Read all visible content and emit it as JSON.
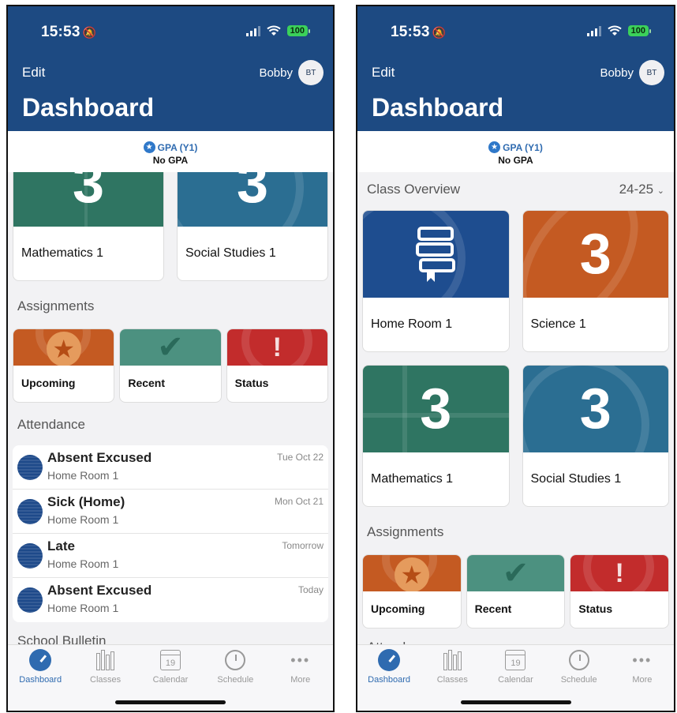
{
  "status": {
    "time": "15:53",
    "battery": "100"
  },
  "header": {
    "edit_label": "Edit",
    "user_name": "Bobby",
    "avatar_initials": "BT",
    "title": "Dashboard"
  },
  "gpa": {
    "label": "GPA (Y1)",
    "value": "No GPA"
  },
  "class_overview": {
    "title": "Class Overview",
    "year": "24-25"
  },
  "classes": [
    {
      "name": "Home Room 1",
      "color": "#1e4d8f"
    },
    {
      "name": "Science 1",
      "badge": "3",
      "color": "#c45a22"
    },
    {
      "name": "Mathematics 1",
      "badge": "3",
      "color": "#2f7562"
    },
    {
      "name": "Social Studies 1",
      "badge": "3",
      "color": "#2b6e92"
    }
  ],
  "assignments": {
    "title": "Assignments",
    "items": [
      {
        "label": "Upcoming",
        "color": "#c45a22"
      },
      {
        "label": "Recent",
        "color": "#2f7562"
      },
      {
        "label": "Status",
        "color": "#c22c2c"
      }
    ]
  },
  "attendance": {
    "title": "Attendance",
    "items": [
      {
        "status": "Absent Excused",
        "class": "Home Room 1",
        "date": "Tue Oct 22"
      },
      {
        "status": "Sick (Home)",
        "class": "Home Room 1",
        "date": "Mon Oct 21"
      },
      {
        "status": "Late",
        "class": "Home Room 1",
        "date": "Tomorrow"
      },
      {
        "status": "Absent Excused",
        "class": "Home Room 1",
        "date": "Today"
      }
    ]
  },
  "bulletin": {
    "title": "School Bulletin"
  },
  "tabbar": {
    "tabs": [
      {
        "label": "Dashboard",
        "icon": "dashboard-icon"
      },
      {
        "label": "Classes",
        "icon": "books-icon"
      },
      {
        "label": "Calendar",
        "icon": "calendar-icon",
        "day": "19"
      },
      {
        "label": "Schedule",
        "icon": "clock-icon"
      },
      {
        "label": "More",
        "icon": "more-icon"
      }
    ]
  }
}
